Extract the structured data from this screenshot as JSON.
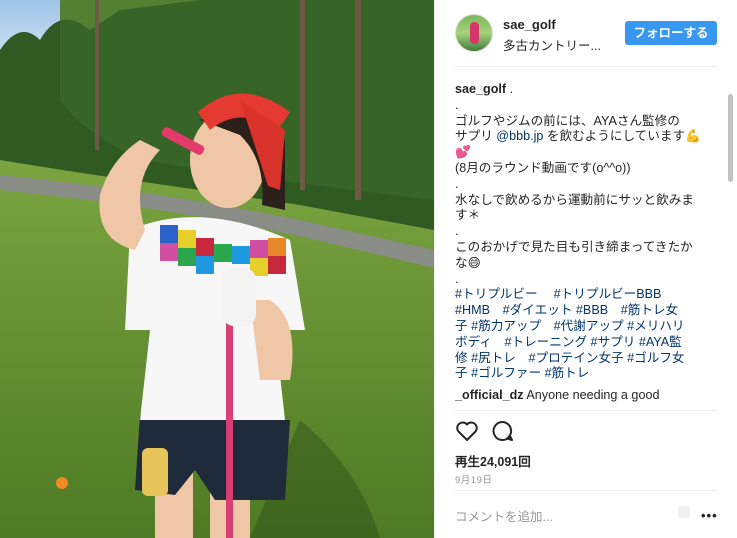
{
  "post": {
    "username": "sae_golf",
    "location": "多古カントリー...",
    "follow_label": "フォローする"
  },
  "caption": {
    "username": "sae_golf",
    "suffix": " .",
    "lines": [
      ".",
      "ゴルフやジムの前には、AYAさん監修の",
      "サプリ ",
      "💕",
      "(8月のラウンド動画です(o^^o))",
      ".",
      "水なしで飲めるから運動前にサッと飲みま",
      "す＊",
      ".",
      "このおかげで見た目も引き締まってきたか",
      "な😄",
      "."
    ],
    "mention": "@bbb.jp",
    "mention_suffix": " を飲むようにしています💪",
    "hashtags": [
      "#トリプルビー　 #トリプルビーBBB",
      "#HMB　#ダイエット #BBB　#筋トレ女",
      "子 #筋力アップ　#代謝アップ #メリハリ",
      "ボディ　#トレーニング #サプリ #AYA監",
      "修 #尻トレ　#プロテイン女子 #ゴルフ女",
      "子 #ゴルファー #筋トレ"
    ]
  },
  "comment1": {
    "username": "_official_dz",
    "text": " Anyone needing a good"
  },
  "actions": {
    "like_icon": "heart-icon",
    "comment_icon": "comment-bubble-icon"
  },
  "stats": {
    "views": "再生24,091回",
    "date": "9月19日"
  },
  "composer": {
    "placeholder": "コメントを追加...",
    "more": "•••"
  },
  "colors": {
    "accent": "#3897f0",
    "link": "#003569",
    "text": "#262626",
    "muted": "#999999"
  }
}
